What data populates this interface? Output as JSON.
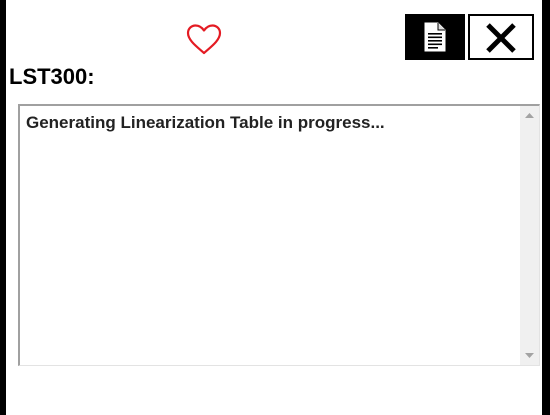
{
  "header": {
    "favorite_icon": "heart-icon",
    "favorite_color": "#e41b23",
    "log_button_icon": "document-icon",
    "close_button_icon": "close-icon"
  },
  "device": {
    "label": "LST300:"
  },
  "log": {
    "lines": [
      "Generating Linearization Table in progress..."
    ]
  },
  "colors": {
    "frame_border": "#000000",
    "log_text": "#222222",
    "scrollbar_track": "#f0f0f0"
  }
}
